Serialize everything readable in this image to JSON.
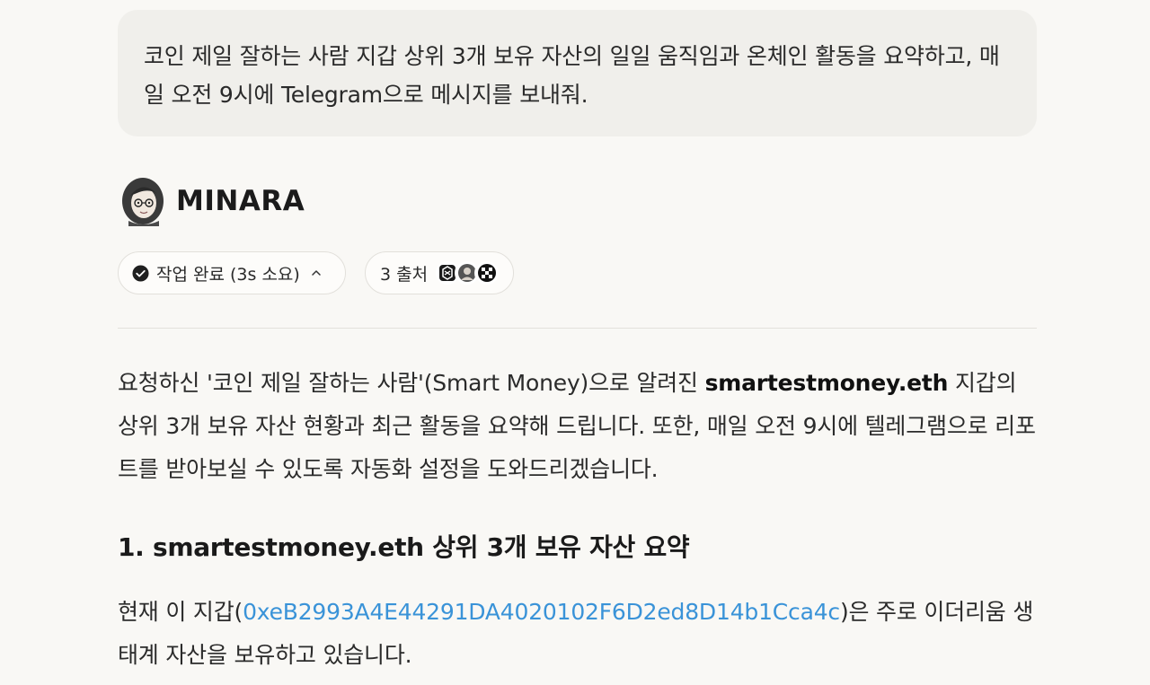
{
  "user_message": {
    "text": "코인 제일 잘하는 사람 지갑 상위 3개 보유 자산의 일일 움직임과 온체인 활동을 요약하고, 매일 오전 9시에 Telegram으로 메시지를 보내줘."
  },
  "assistant": {
    "name": "MINARA",
    "avatar_icon": "character-portrait-icon"
  },
  "status_pill": {
    "label": "작업 완료 (3s 소요)",
    "icon": "check-circle-icon",
    "chevron": "chevron-up-icon"
  },
  "sources_pill": {
    "label": "3 출처",
    "icons": [
      "source-logo-1-icon",
      "source-logo-2-icon",
      "source-logo-3-icon"
    ]
  },
  "answer": {
    "intro_part1": "요청하신 '코인 제일 잘하는 사람'(Smart Money)으로 알려진 ",
    "intro_bold": "smartestmoney.eth",
    "intro_part2": " 지갑의 상위 3개 보유 자산 현황과 최근 활동을 요약해 드립니다. 또한, 매일 오전 9시에 텔레그램으로 리포트를 받아보실 수 있도록 자동화 설정을 도와드리겠습니다.",
    "section_title": "1. smartestmoney.eth 상위 3개 보유 자산 요약",
    "wallet_before": "현재 이 지갑(",
    "wallet_address": "0xeB2993A4E44291DA4020102F6D2ed8D14b1Cca4c",
    "wallet_after": ")은 주로 이더리움 생태계 자산을 보유하고 있습니다."
  },
  "colors": {
    "background": "#f9f8f5",
    "bubble": "#f0efeb",
    "link": "#3a93d8"
  }
}
